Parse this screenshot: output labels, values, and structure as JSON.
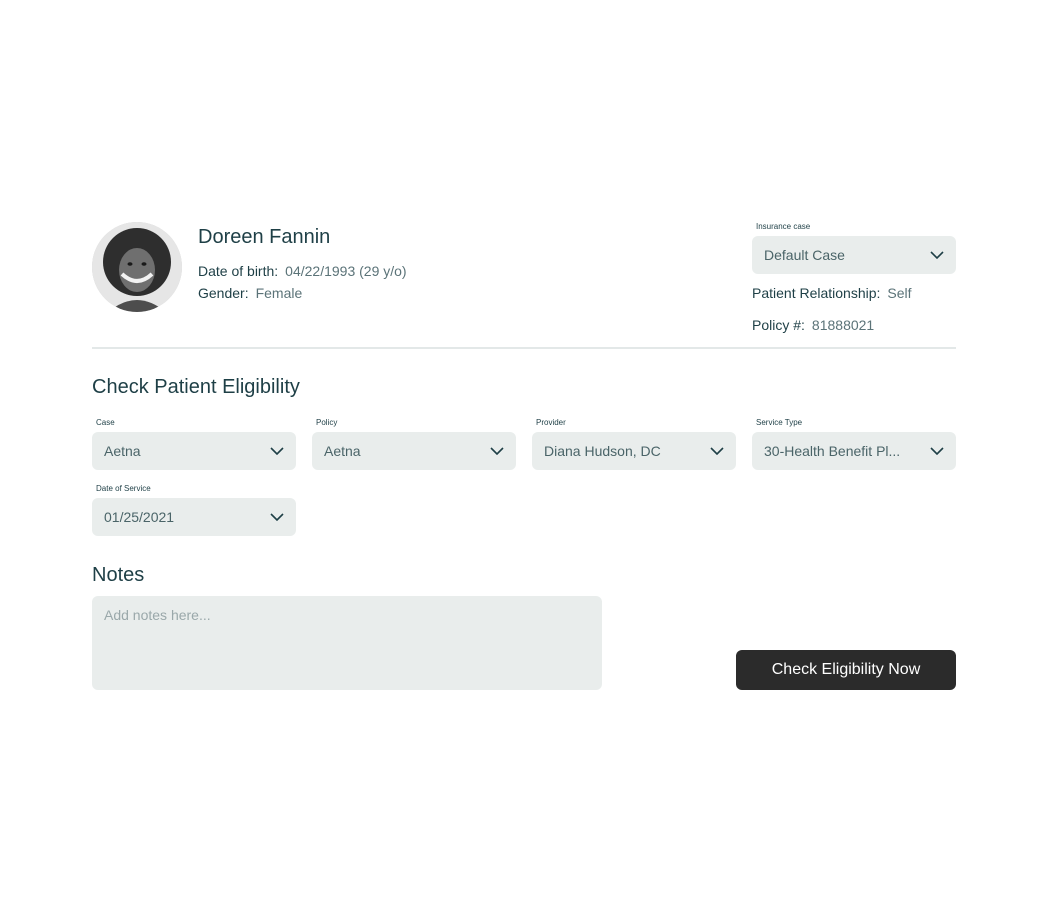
{
  "patient": {
    "name": "Doreen Fannin",
    "dob_label": "Date of birth:",
    "dob_value": "04/22/1993 (29 y/o)",
    "gender_label": "Gender:",
    "gender_value": "Female"
  },
  "insurance": {
    "case_label": "Insurance case",
    "case_value": "Default Case",
    "relationship_label": "Patient Relationship:",
    "relationship_value": "Self",
    "policy_label": "Policy #:",
    "policy_value": "81888021"
  },
  "eligibility": {
    "title": "Check Patient Eligibility",
    "fields": [
      {
        "label": "Case",
        "value": "Aetna"
      },
      {
        "label": "Policy",
        "value": "Aetna"
      },
      {
        "label": "Provider",
        "value": "Diana Hudson, DC"
      },
      {
        "label": "Service Type",
        "value": "30-Health Benefit Pl..."
      },
      {
        "label": "Date of Service",
        "value": "01/25/2021"
      }
    ]
  },
  "notes": {
    "title": "Notes",
    "placeholder": "Add notes here..."
  },
  "actions": {
    "check_label": "Check Eligibility Now"
  },
  "icons": {
    "dropdown": "chevron-down-icon",
    "avatar": "user-avatar-photo"
  },
  "colors": {
    "text_primary": "#1e3f46",
    "text_secondary": "#5b7378",
    "field_bg": "#e9edec",
    "button_bg": "#2b2b2b",
    "button_text": "#ffffff"
  }
}
